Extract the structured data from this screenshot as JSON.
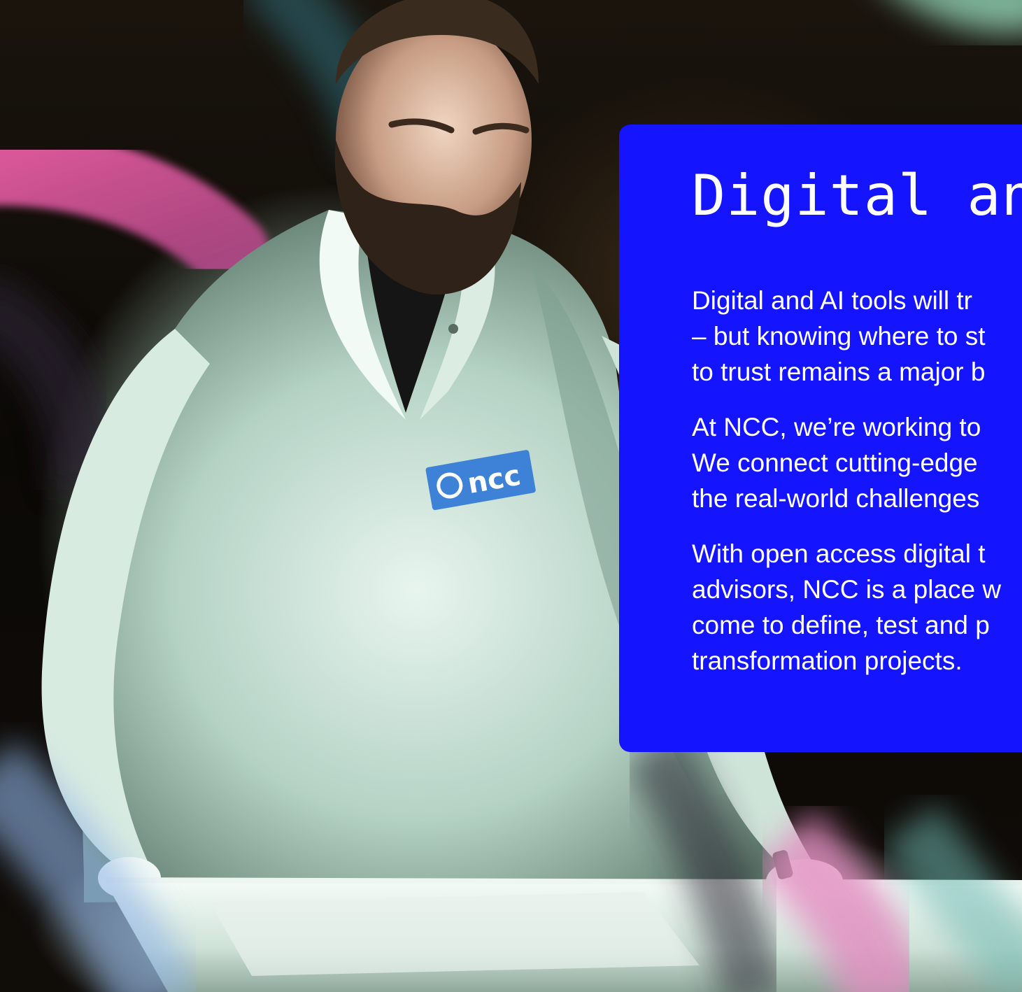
{
  "hero": {
    "badge_text": "ncc"
  },
  "card": {
    "title": "Digital and",
    "paragraphs": [
      [
        "Digital and AI tools will tr",
        "– but knowing where to st",
        "to trust remains a major b"
      ],
      [
        "At NCC, we’re working to",
        "We connect cutting-edge",
        "the real-world challenges"
      ],
      [
        "With open access digital t",
        "advisors, NCC is a place w",
        "come to define, test and p",
        "transformation projects."
      ]
    ]
  },
  "colors": {
    "card_background": "#1414ff",
    "card_text": "#ffffff",
    "swoosh_pink": "#e8579f",
    "swoosh_mint": "#9fe6c8",
    "badge_blue": "#3d82d6"
  }
}
